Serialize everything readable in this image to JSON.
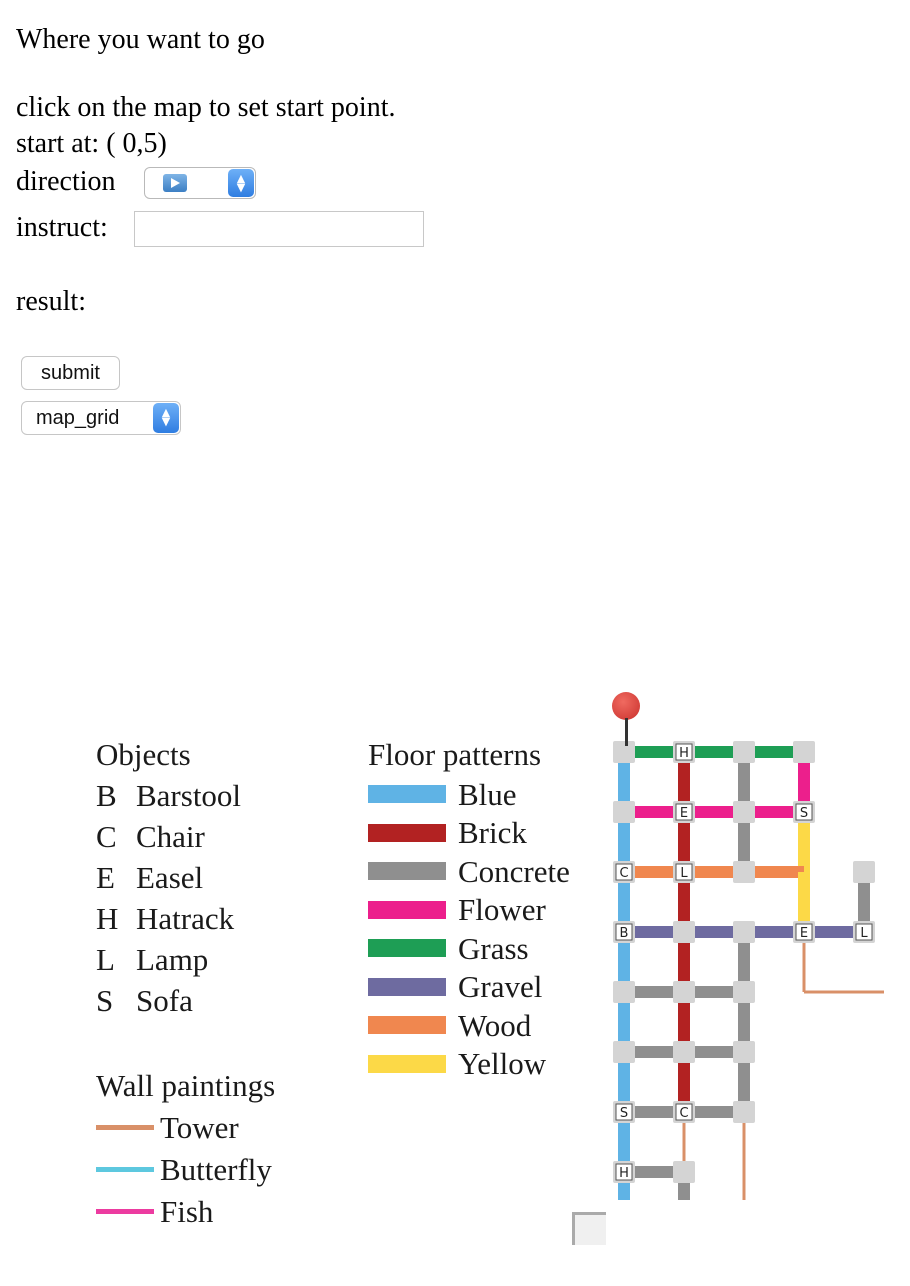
{
  "header": {
    "title": "Where you want to go"
  },
  "form": {
    "hint": "click on the map to set start point.",
    "start_label": "start at: ( 0,5)",
    "direction_label": "direction",
    "instruct_label": "instruct:",
    "instruct_value": "",
    "result_label": "result:",
    "submit_label": "submit",
    "map_select_value": "map_grid"
  },
  "legend": {
    "objects_title": "Objects",
    "objects": [
      {
        "code": "B",
        "name": "Barstool"
      },
      {
        "code": "C",
        "name": "Chair"
      },
      {
        "code": "E",
        "name": "Easel"
      },
      {
        "code": "H",
        "name": "Hatrack"
      },
      {
        "code": "L",
        "name": "Lamp"
      },
      {
        "code": "S",
        "name": "Sofa"
      }
    ],
    "floor_title": "Floor patterns",
    "floors": [
      {
        "name": "Blue",
        "color": "#5fb3e5"
      },
      {
        "name": "Brick",
        "color": "#b22222"
      },
      {
        "name": "Concrete",
        "color": "#8f8f8f"
      },
      {
        "name": "Flower",
        "color": "#ec1f8c"
      },
      {
        "name": "Grass",
        "color": "#1e9e55"
      },
      {
        "name": "Gravel",
        "color": "#6e6ba0"
      },
      {
        "name": "Wood",
        "color": "#f0874f"
      },
      {
        "name": "Yellow",
        "color": "#fcd947"
      }
    ],
    "walls_title": "Wall paintings",
    "walls": [
      {
        "name": "Tower",
        "color": "#d99068"
      },
      {
        "name": "Butterfly",
        "color": "#5dc8df"
      },
      {
        "name": "Fish",
        "color": "#ec3ba0"
      }
    ]
  },
  "map": {
    "node_color": "#d4d4d4",
    "labels": [
      {
        "letter": "H",
        "col": 2,
        "row": 0
      },
      {
        "letter": "E",
        "col": 2,
        "row": 1
      },
      {
        "letter": "S",
        "col": 5,
        "row": 1
      },
      {
        "letter": "C",
        "col": 0,
        "row": 2
      },
      {
        "letter": "L",
        "col": 2,
        "row": 2
      },
      {
        "letter": "B",
        "col": 0,
        "row": 3
      },
      {
        "letter": "E",
        "col": 5,
        "row": 3
      },
      {
        "letter": "L",
        "col": 6,
        "row": 3
      },
      {
        "letter": "S",
        "col": 0,
        "row": 5
      },
      {
        "letter": "C",
        "col": 2,
        "row": 5
      },
      {
        "letter": "H",
        "col": 0,
        "row": 6
      }
    ]
  }
}
